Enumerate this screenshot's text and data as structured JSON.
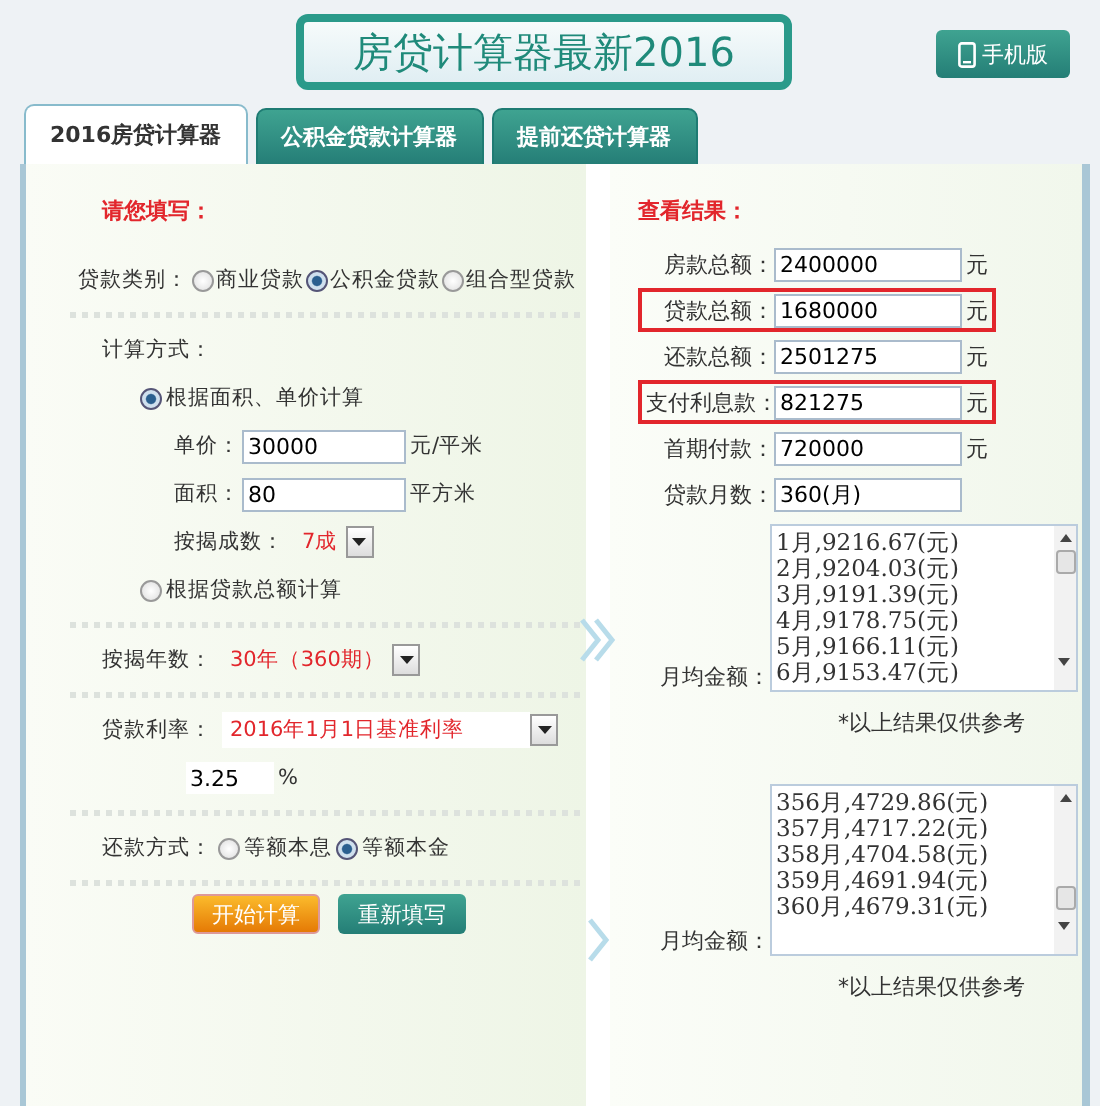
{
  "header": {
    "title": "房贷计算器最新2016",
    "mobile_button": "手机版"
  },
  "tabs": [
    {
      "label": "2016房贷计算器",
      "selected": true
    },
    {
      "label": "公积金贷款计算器",
      "selected": false
    },
    {
      "label": "提前还贷计算器",
      "selected": false
    }
  ],
  "form": {
    "heading": "请您填写：",
    "loan_type": {
      "label": "贷款类别：",
      "options": [
        {
          "label": "商业贷款",
          "selected": false
        },
        {
          "label": "公积金贷款",
          "selected": true
        },
        {
          "label": "组合型贷款",
          "selected": false
        }
      ]
    },
    "method": {
      "label": "计算方式：",
      "options": [
        {
          "label": "根据面积、单价计算",
          "selected": true
        },
        {
          "label": "根据贷款总额计算",
          "selected": false
        }
      ],
      "fields": [
        {
          "label": "单价：",
          "value": "30000",
          "unit": "元/平米"
        },
        {
          "label": "面积：",
          "value": "80",
          "unit": "平方米"
        }
      ],
      "ratio": {
        "label": "按揭成数：",
        "value": "7成"
      }
    },
    "years": {
      "label": "按揭年数：",
      "value": "30年（360期）"
    },
    "rate": {
      "label": "贷款利率：",
      "value": "2016年1月1日基准利率",
      "percent_value": "3.25",
      "percent_unit": "%"
    },
    "repayment": {
      "label": "还款方式：",
      "options": [
        {
          "label": "等额本息",
          "selected": false
        },
        {
          "label": "等额本金",
          "selected": true
        }
      ]
    },
    "buttons": [
      {
        "label": "开始计算",
        "kind": "primary"
      },
      {
        "label": "重新填写",
        "kind": "secondary"
      }
    ]
  },
  "results": {
    "heading": "查看结果：",
    "rows": [
      {
        "label": "房款总额：",
        "value": "2400000",
        "unit": "元",
        "highlighted": false
      },
      {
        "label": "贷款总额：",
        "value": "1680000",
        "unit": "元",
        "highlighted": true
      },
      {
        "label": "还款总额：",
        "value": "2501275",
        "unit": "元",
        "highlighted": false
      },
      {
        "label": "支付利息款：",
        "value": "821275",
        "unit": "元",
        "highlighted": true
      },
      {
        "label": "首期付款：",
        "value": "720000",
        "unit": "元",
        "highlighted": false
      },
      {
        "label": "贷款月数：",
        "value": "360(月)",
        "highlighted": false
      }
    ],
    "schedules": [
      {
        "label": "月均金额：",
        "lines": [
          "1月,9216.67(元)",
          "2月,9204.03(元)",
          "3月,9191.39(元)",
          "4月,9178.75(元)",
          "5月,9166.11(元)",
          "6月,9153.47(元)"
        ],
        "note": "*以上结果仅供参考"
      },
      {
        "label": "月均金额：",
        "lines": [
          "356月,4729.86(元)",
          "357月,4717.22(元)",
          "358月,4704.58(元)",
          "359月,4691.94(元)",
          "360月,4679.31(元)"
        ],
        "note": "*以上结果仅供参考"
      }
    ]
  }
}
